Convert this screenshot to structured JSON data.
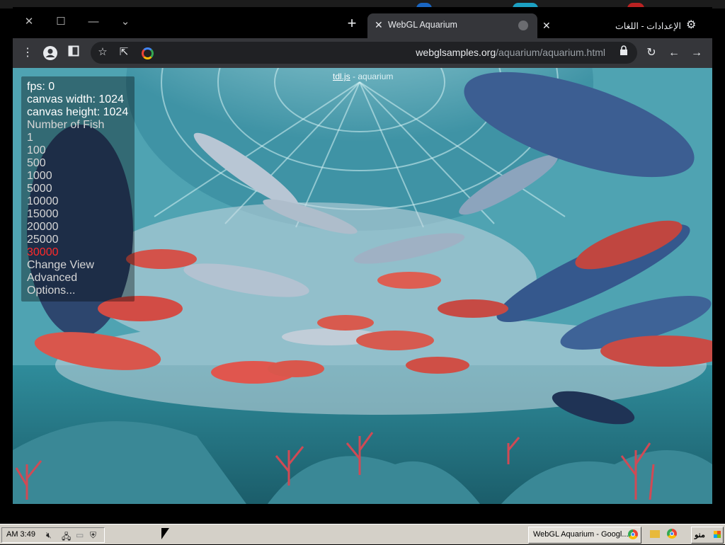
{
  "browser": {
    "window_controls": {
      "close": "✕",
      "maximize": "☐",
      "minimize": "—",
      "dropdown": "⌄"
    },
    "new_tab_glyph": "+",
    "tabs": [
      {
        "title": "WebGL Aquarium",
        "active": true
      },
      {
        "title": "الإعدادات - اللغات",
        "active": false
      }
    ],
    "toolbar_icons": [
      "more-icon",
      "profile-icon",
      "side-panel-icon",
      "star-icon",
      "share-icon",
      "reload-icon",
      "back-icon",
      "forward-icon"
    ],
    "url": {
      "host": "webglsamples.org",
      "path": "/aquarium/aquarium.html"
    }
  },
  "page": {
    "title_link": "tdl.js",
    "title_rest": " - aquarium",
    "stats": {
      "fps": "fps: 0",
      "canvas_width": "canvas width: 1024",
      "canvas_height": "canvas height: 1024"
    },
    "menu": {
      "heading": "Number of Fish",
      "options": [
        "1",
        "100",
        "500",
        "1000",
        "5000",
        "10000",
        "15000",
        "20000",
        "25000",
        "30000"
      ],
      "selected": "30000",
      "change_view": "Change View",
      "advanced": "Advanced",
      "options_label": "Options..."
    },
    "colors": {
      "selected": "#ff2a2a",
      "menu_text": "#d6d6d6",
      "water": "#5aa7b5"
    }
  },
  "taskbar": {
    "clock": "AM 3:49",
    "task_label": "WebGL Aquarium - Googl...",
    "start_label": "منو"
  }
}
